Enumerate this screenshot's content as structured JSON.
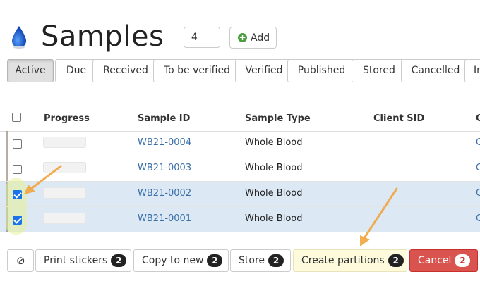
{
  "header": {
    "title": "Samples",
    "count_value": "4",
    "add_label": "Add",
    "icon": "water-drop-icon"
  },
  "tabs": [
    {
      "label": "Active",
      "active": true
    },
    {
      "label": "Due",
      "active": false
    },
    {
      "label": "Received",
      "active": false
    },
    {
      "label": "To be verified",
      "active": false
    },
    {
      "label": "Verified",
      "active": false
    },
    {
      "label": "Published",
      "active": false
    },
    {
      "label": "Stored",
      "active": false
    },
    {
      "label": "Cancelled",
      "active": false
    },
    {
      "label": "In",
      "active": false
    }
  ],
  "table": {
    "columns": [
      "Progress",
      "Sample ID",
      "Sample Type",
      "Client SID",
      "C"
    ],
    "rows": [
      {
        "sample_id": "WB21-0004",
        "sample_type": "Whole Blood",
        "client_sid": "",
        "client": "C",
        "checked": false
      },
      {
        "sample_id": "WB21-0003",
        "sample_type": "Whole Blood",
        "client_sid": "",
        "client": "C",
        "checked": false
      },
      {
        "sample_id": "WB21-0002",
        "sample_type": "Whole Blood",
        "client_sid": "",
        "client": "C",
        "checked": true
      },
      {
        "sample_id": "WB21-0001",
        "sample_type": "Whole Blood",
        "client_sid": "",
        "client": "C",
        "checked": true
      }
    ]
  },
  "actions": {
    "clear_icon": "ban-icon",
    "print_stickers": {
      "label": "Print stickers",
      "count": "2"
    },
    "copy_to_new": {
      "label": "Copy to new",
      "count": "2"
    },
    "store": {
      "label": "Store",
      "count": "2"
    },
    "create_partitions": {
      "label": "Create partitions",
      "count": "2"
    },
    "cancel": {
      "label": "Cancel",
      "count": "2"
    }
  },
  "colors": {
    "accent_link": "#3a6fa8",
    "danger": "#d9534f",
    "selected_row": "#dce9f5",
    "annotation_arrow": "#f0a540"
  }
}
